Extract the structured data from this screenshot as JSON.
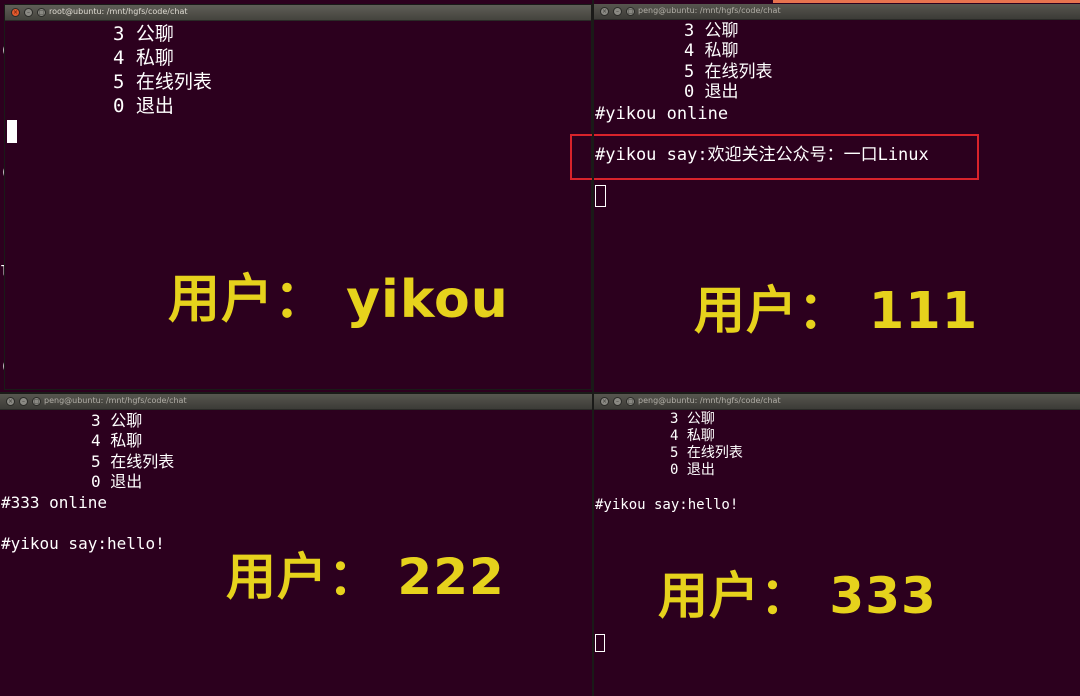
{
  "windows": {
    "top_left": {
      "title": "root@ubuntu: /mnt/hgfs/code/chat",
      "lines": [
        "3 公聊",
        "4 私聊",
        "5 在线列表",
        "0 退出"
      ],
      "overlay": "用户： yikou"
    },
    "top_right": {
      "title": "peng@ubuntu: /mnt/hgfs/code/chat",
      "lines": [
        "3 公聊",
        "4 私聊",
        "5 在线列表",
        "0 退出",
        "#yikou online",
        "#yikou say:欢迎关注公众号：一口Linux"
      ],
      "overlay": "用户： 111"
    },
    "bottom_left": {
      "title": "peng@ubuntu: /mnt/hgfs/code/chat",
      "lines": [
        "3 公聊",
        "4 私聊",
        "5 在线列表",
        "0 退出",
        "#333 online",
        "#yikou say:hello!"
      ],
      "overlay": "用户： 222"
    },
    "bottom_right": {
      "title": "peng@ubuntu: /mnt/hgfs/code/chat",
      "lines": [
        "3 公聊",
        "4 私聊",
        "5 在线列表",
        "0 退出",
        "#yikou say:hello!"
      ],
      "overlay": "用户： 333"
    }
  },
  "colors": {
    "terminal_bg": "#2c001e",
    "overlay_text": "#e6d21c",
    "highlight_border": "#d9232b"
  },
  "icons": [
    "close-icon",
    "minimize-icon",
    "maximize-icon"
  ]
}
